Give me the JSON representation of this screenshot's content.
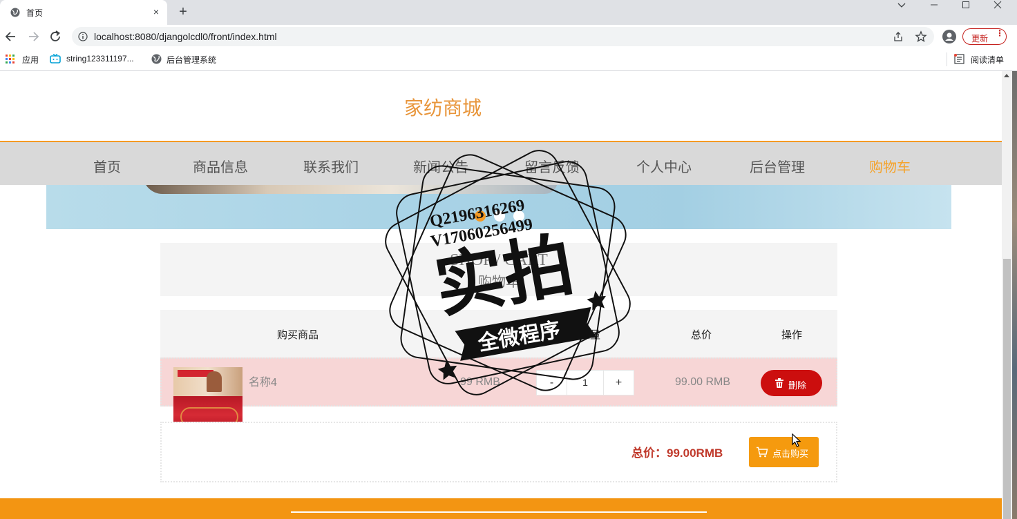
{
  "browser": {
    "tab_title": "首页",
    "tab_close": "×",
    "new_tab": "+",
    "url": "localhost:8080/djangolcdl0/front/index.html",
    "update_label": "更新",
    "update_menu": "⋮",
    "bookmarks": [
      {
        "label": "应用",
        "icon": "apps-grid-icon"
      },
      {
        "label": "string123311197...",
        "icon": "tv-icon"
      },
      {
        "label": "后台管理系统",
        "icon": "globe-icon"
      }
    ],
    "reading_list": "阅读清单"
  },
  "site": {
    "title": "家纺商城",
    "accent_color": "#f59a23",
    "nav": [
      {
        "label": "首页",
        "active": false
      },
      {
        "label": "商品信息",
        "active": false
      },
      {
        "label": "联系我们",
        "active": false
      },
      {
        "label": "新闻公告",
        "active": false
      },
      {
        "label": "留言反馈",
        "active": false
      },
      {
        "label": "个人中心",
        "active": false
      },
      {
        "label": "后台管理",
        "active": false
      },
      {
        "label": "购物车",
        "active": true
      }
    ]
  },
  "cart": {
    "title_en": "SHOP / CART",
    "title_cn": "购物车",
    "columns": {
      "product": "购买商品",
      "quantity": "数量",
      "total": "总价",
      "action": "操作"
    },
    "items": [
      {
        "name": "名称4",
        "price": "99 RMB",
        "quantity": "1",
        "minus": "-",
        "plus": "+",
        "total": "99.00 RMB",
        "delete_label": "删除"
      }
    ],
    "grand_total_label": "总价：99.00RMB",
    "buy_label": "点击购买"
  },
  "watermark": {
    "line1": "Q2196316269",
    "line2": "V17060256499",
    "main": "实拍",
    "ribbon": "全微程序"
  }
}
